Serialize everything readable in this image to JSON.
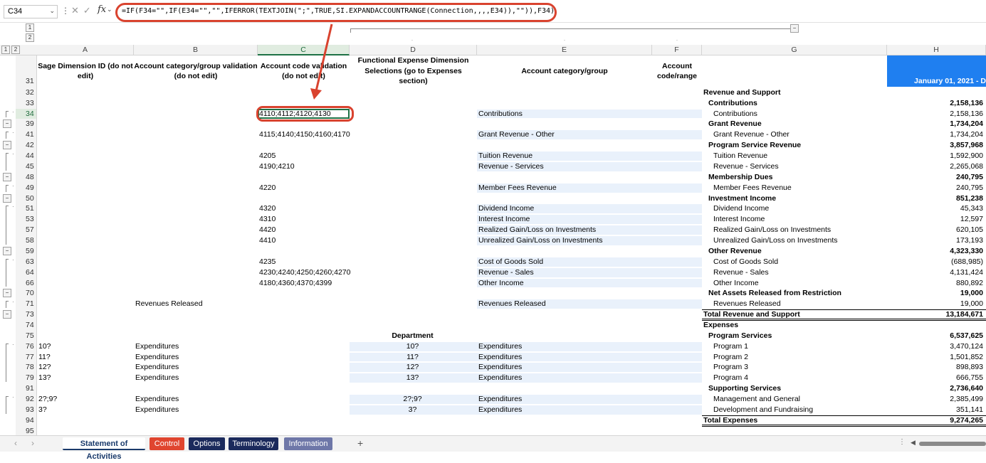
{
  "name_box": "C34",
  "formula": "=IF(F34=\"\",IF(E34=\"\",\"\",IFERROR(TEXTJOIN(\";\",TRUE,SI.EXPANDACCOUNTRANGE(Connection,,,,E34)),\"\")),F34)",
  "outline_levels": [
    "1",
    "2"
  ],
  "columns": [
    "A",
    "B",
    "C",
    "D",
    "E",
    "F",
    "G",
    "H"
  ],
  "header_row": "31",
  "headers": {
    "a": "Sage Dimension ID (do not edit)",
    "b": "Account category/group validation (do not edit)",
    "c": "Account code validation (do not edit)",
    "d": "Functional Expense Dimension Selections (go to Expenses section)",
    "e": "Account category/group",
    "f": "Account code/range",
    "h": "January 01, 2021 - D"
  },
  "rows": [
    {
      "n": "32",
      "g": "Revenue and Support",
      "gb": true
    },
    {
      "n": "33",
      "g": "Contributions",
      "gb": true,
      "gi": 1,
      "h": "2,158,136",
      "hb": true
    },
    {
      "n": "34",
      "c": "4110;4112;4120;4130",
      "e": "Contributions",
      "g": "Contributions",
      "gi": 2,
      "h": "2,158,136"
    },
    {
      "n": "39",
      "g": "Grant Revenue",
      "gb": true,
      "gi": 1,
      "h": "1,734,204",
      "hb": true
    },
    {
      "n": "41",
      "c": "4115;4140;4150;4160;4170",
      "e": "Grant Revenue - Other",
      "g": "Grant Revenue - Other",
      "gi": 2,
      "h": "1,734,204"
    },
    {
      "n": "42",
      "g": "Program Service Revenue",
      "gb": true,
      "gi": 1,
      "h": "3,857,968",
      "hb": true
    },
    {
      "n": "44",
      "c": "4205",
      "e": "Tuition Revenue",
      "g": "Tuition Revenue",
      "gi": 2,
      "h": "1,592,900"
    },
    {
      "n": "45",
      "c": "4190;4210",
      "e": "Revenue - Services",
      "g": "Revenue - Services",
      "gi": 2,
      "h": "2,265,068"
    },
    {
      "n": "48",
      "g": "Membership Dues",
      "gb": true,
      "gi": 1,
      "h": "240,795",
      "hb": true
    },
    {
      "n": "49",
      "c": "4220",
      "e": "Member Fees Revenue",
      "g": "Member Fees Revenue",
      "gi": 2,
      "h": "240,795"
    },
    {
      "n": "50",
      "g": "Investment Income",
      "gb": true,
      "gi": 1,
      "h": "851,238",
      "hb": true
    },
    {
      "n": "51",
      "c": "4320",
      "e": "Dividend Income",
      "g": "Dividend Income",
      "gi": 2,
      "h": "45,343"
    },
    {
      "n": "53",
      "c": "4310",
      "e": "Interest Income",
      "g": "Interest Income",
      "gi": 2,
      "h": "12,597"
    },
    {
      "n": "57",
      "c": "4420",
      "e": "Realized Gain/Loss on Investments",
      "g": "Realized Gain/Loss on Investments",
      "gi": 2,
      "h": "620,105"
    },
    {
      "n": "58",
      "c": "4410",
      "e": "Unrealized Gain/Loss on Investments",
      "g": "Unrealized Gain/Loss on Investments",
      "gi": 2,
      "h": "173,193"
    },
    {
      "n": "59",
      "g": "Other Revenue",
      "gb": true,
      "gi": 1,
      "h": "4,323,330",
      "hb": true
    },
    {
      "n": "63",
      "c": "4235",
      "e": "Cost of Goods Sold",
      "g": "Cost of Goods Sold",
      "gi": 2,
      "h": "(688,985)"
    },
    {
      "n": "64",
      "c": "4230;4240;4250;4260;4270",
      "e": "Revenue - Sales",
      "g": "Revenue - Sales",
      "gi": 2,
      "h": "4,131,424"
    },
    {
      "n": "66",
      "c": "4180;4360;4370;4399",
      "e": "Other Income",
      "g": "Other Income",
      "gi": 2,
      "h": "880,892"
    },
    {
      "n": "70",
      "g": "Net Assets Released from Restriction",
      "gb": true,
      "gi": 1,
      "h": "19,000",
      "hb": true
    },
    {
      "n": "71",
      "b": "Revenues Released",
      "e": "Revenues Released",
      "g": "Revenues Released",
      "gi": 2,
      "h": "19,000"
    },
    {
      "n": "73",
      "g": "Total Revenue and Support",
      "gb": true,
      "h": "13,184,671",
      "hb": true
    },
    {
      "n": "74",
      "g": "Expenses",
      "gb": true
    },
    {
      "n": "75",
      "d": "Department",
      "db": true,
      "g": "Program Services",
      "gb": true,
      "gi": 1,
      "h": "6,537,625",
      "hb": true
    },
    {
      "n": "76",
      "a": "10?",
      "b": "Expenditures",
      "d": "10?",
      "e": "Expenditures",
      "g": "Program 1",
      "gi": 2,
      "h": "3,470,124"
    },
    {
      "n": "77",
      "a": "11?",
      "b": "Expenditures",
      "d": "11?",
      "e": "Expenditures",
      "g": "Program 2",
      "gi": 2,
      "h": "1,501,852"
    },
    {
      "n": "78",
      "a": "12?",
      "b": "Expenditures",
      "d": "12?",
      "e": "Expenditures",
      "g": "Program 3",
      "gi": 2,
      "h": "898,893"
    },
    {
      "n": "79",
      "a": "13?",
      "b": "Expenditures",
      "d": "13?",
      "e": "Expenditures",
      "g": "Program 4",
      "gi": 2,
      "h": "666,755"
    },
    {
      "n": "91",
      "g": "Supporting Services",
      "gb": true,
      "gi": 1,
      "h": "2,736,640",
      "hb": true
    },
    {
      "n": "92",
      "a": "2?;9?",
      "b": "Expenditures",
      "d": "2?;9?",
      "e": "Expenditures",
      "g": "Management and General",
      "gi": 2,
      "h": "2,385,499"
    },
    {
      "n": "93",
      "a": "3?",
      "b": "Expenditures",
      "d": "3?",
      "e": "Expenditures",
      "g": "Development and Fundraising",
      "gi": 2,
      "h": "351,141"
    },
    {
      "n": "94",
      "g": "Total Expenses",
      "gb": true,
      "h": "9,274,265",
      "hb": true
    },
    {
      "n": "95"
    }
  ],
  "sheet_tabs": [
    {
      "label": "Statement of Activities",
      "active": true,
      "bg": "#f3f3f3",
      "fg": "#1a3a6b"
    },
    {
      "label": "Control",
      "active": false,
      "bg": "#e0452f",
      "fg": "#ffffff"
    },
    {
      "label": "Options",
      "active": false,
      "bg": "#1b2a5c",
      "fg": "#ffffff"
    },
    {
      "label": "Terminology",
      "active": false,
      "bg": "#1b2a5c",
      "fg": "#ffffff"
    },
    {
      "label": "Information",
      "active": false,
      "bg": "#6e77a8",
      "fg": "#ffffff"
    }
  ],
  "add_sheet": "+",
  "accent_colors": {
    "annotation": "#d9432f",
    "header_fill": "#1f7ff0",
    "selection": "#1e7145",
    "tint": "#e9f1fb"
  }
}
